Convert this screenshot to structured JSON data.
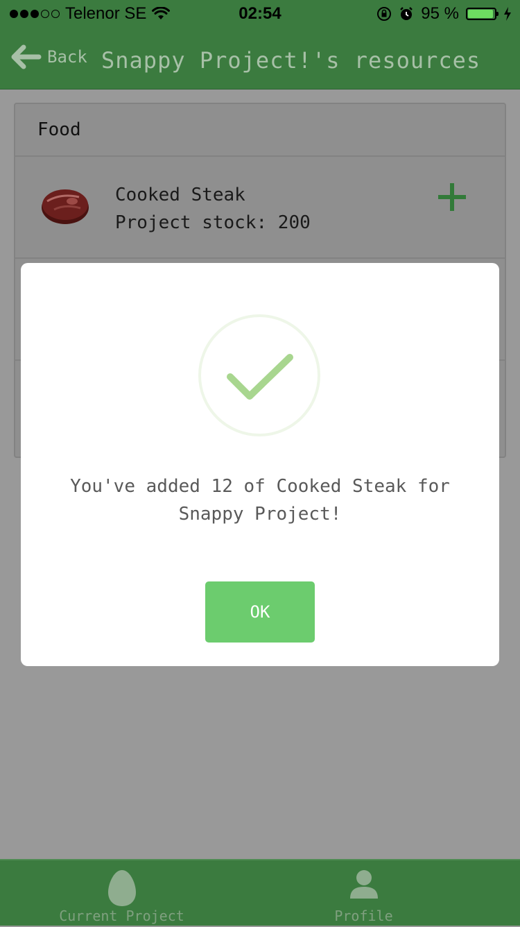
{
  "status_bar": {
    "carrier": "Telenor SE",
    "time": "02:54",
    "battery_percent": "95 %",
    "battery_level": 0.95,
    "signal_bars": 3,
    "signal_total": 5
  },
  "nav": {
    "back_label": "Back",
    "title": "Snappy Project!'s resources"
  },
  "section": {
    "header": "Food"
  },
  "resource": {
    "name": "Cooked Steak",
    "stock": "Project stock: 200"
  },
  "modal": {
    "message": "You've added 12 of Cooked Steak for Snappy Project!",
    "ok_label": "OK"
  },
  "tabs": [
    {
      "label": "Current Project",
      "icon": "egg-icon"
    },
    {
      "label": "Profile",
      "icon": "person-icon"
    }
  ],
  "colors": {
    "brand_green": "#3b7b3f",
    "accent_green": "#6ccc6e",
    "check_green": "#a8d68f",
    "overlay_gray": "#999999"
  }
}
